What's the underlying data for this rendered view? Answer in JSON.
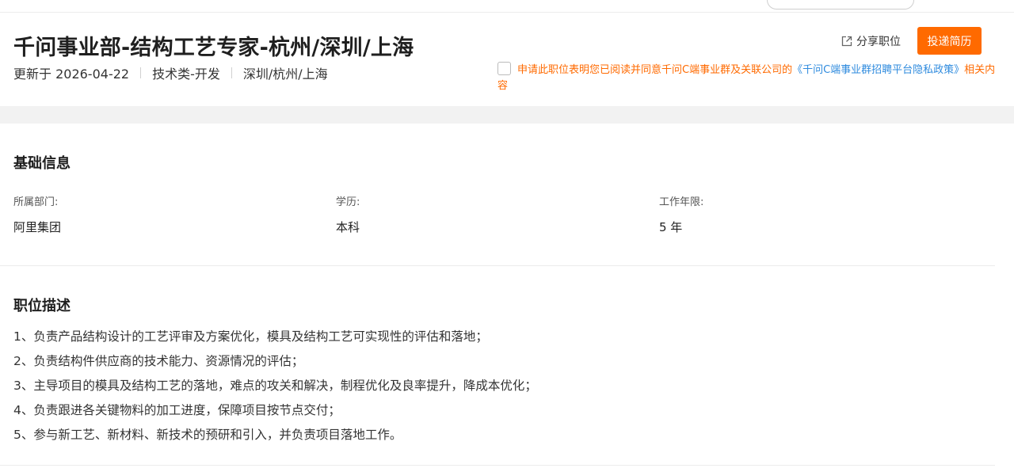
{
  "job": {
    "title": "千问事业部-结构工艺专家-杭州/深圳/上海",
    "updated": "更新于 2026-04-22",
    "category": "技术类-开发",
    "locations": "深圳/杭州/上海"
  },
  "actions": {
    "share_label": "分享职位",
    "apply_label": "投递简历"
  },
  "consent": {
    "text_before": "申请此职位表明您已阅读并同意千问C端事业群及关联公司的",
    "policy_link": "《千问C端事业群招聘平台隐私政策》",
    "text_after": "相关内容"
  },
  "basic_info": {
    "title": "基础信息",
    "fields": [
      {
        "label": "所属部门:",
        "value": "阿里集团"
      },
      {
        "label": "学历:",
        "value": "本科"
      },
      {
        "label": "工作年限:",
        "value": "5 年"
      }
    ]
  },
  "description": {
    "title": "职位描述",
    "items": [
      "1、负责产品结构设计的工艺评审及方案优化，模具及结构工艺可实现性的评估和落地；",
      "2、负责结构件供应商的技术能力、资源情况的评估；",
      "3、主导项目的模具及结构工艺的落地，难点的攻关和解决，制程优化及良率提升，降成本优化；",
      "4、负责跟进各关键物料的加工进度，保障项目按节点交付；",
      "5、参与新工艺、新材料、新技术的预研和引入，并负责项目落地工作。"
    ]
  },
  "colors": {
    "accent": "#ff6a00",
    "link": "#2f8bde"
  }
}
